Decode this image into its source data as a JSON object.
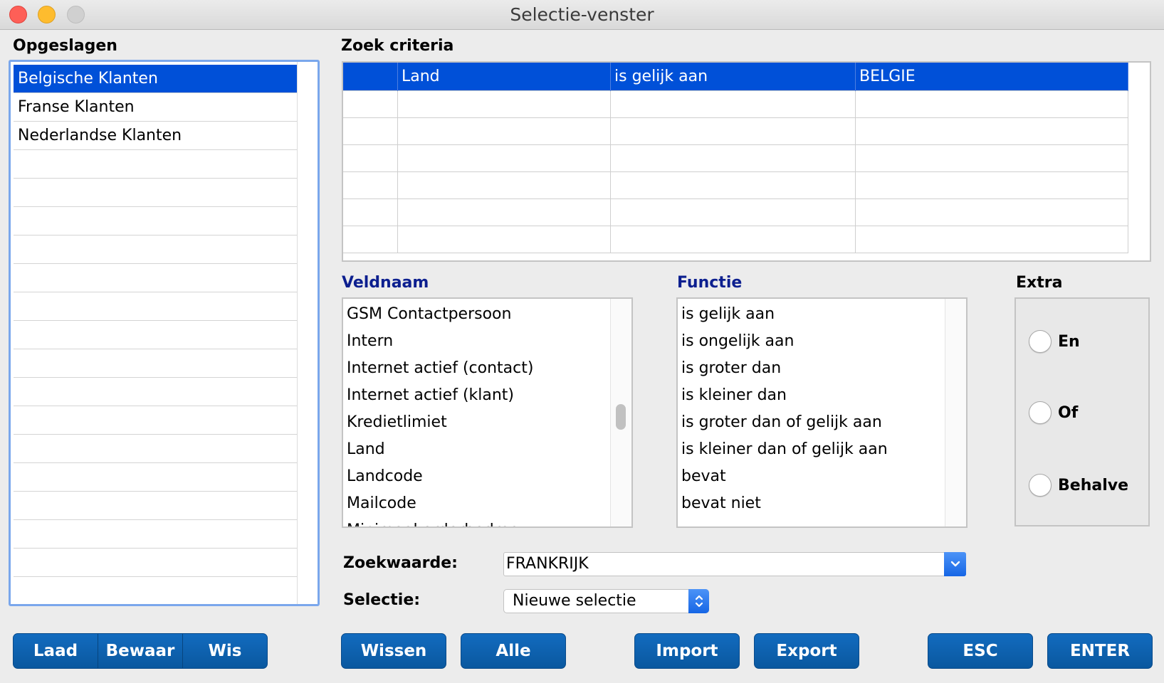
{
  "window": {
    "title": "Selectie-venster"
  },
  "saved": {
    "label": "Opgeslagen",
    "items": [
      {
        "label": "Belgische Klanten",
        "selected": true
      },
      {
        "label": "Franse Klanten",
        "selected": false
      },
      {
        "label": "Nederlandse Klanten",
        "selected": false
      },
      {
        "label": ""
      },
      {
        "label": ""
      },
      {
        "label": ""
      },
      {
        "label": ""
      },
      {
        "label": ""
      },
      {
        "label": ""
      },
      {
        "label": ""
      },
      {
        "label": ""
      },
      {
        "label": ""
      },
      {
        "label": ""
      },
      {
        "label": ""
      },
      {
        "label": ""
      },
      {
        "label": ""
      },
      {
        "label": ""
      },
      {
        "label": ""
      },
      {
        "label": ""
      }
    ]
  },
  "criteria": {
    "label": "Zoek criteria",
    "rows": [
      {
        "n": "",
        "field": "Land",
        "op": "is gelijk aan",
        "value": "BELGIE",
        "selected": true
      },
      {
        "n": "",
        "field": "",
        "op": "",
        "value": ""
      },
      {
        "n": "",
        "field": "",
        "op": "",
        "value": ""
      },
      {
        "n": "",
        "field": "",
        "op": "",
        "value": ""
      },
      {
        "n": "",
        "field": "",
        "op": "",
        "value": ""
      },
      {
        "n": "",
        "field": "",
        "op": "",
        "value": ""
      },
      {
        "n": "",
        "field": "",
        "op": "",
        "value": ""
      }
    ]
  },
  "fields": {
    "label": "Veldnaam",
    "items": [
      "GSM Contactpersoon",
      "Intern",
      "Internet actief (contact)",
      "Internet actief (klant)",
      "Kredietlimiet",
      "Land",
      "Landcode",
      "Mailcode",
      "Minimaal orderbedrag"
    ]
  },
  "functions": {
    "label": "Functie",
    "items": [
      "is gelijk aan",
      "is ongelijk aan",
      "is groter dan",
      "is kleiner dan",
      "is groter dan of gelijk aan",
      "is kleiner dan of gelijk aan",
      "bevat",
      "bevat niet"
    ]
  },
  "extra": {
    "label": "Extra",
    "options": [
      "En",
      "Of",
      "Behalve"
    ]
  },
  "form": {
    "search_label": "Zoekwaarde:",
    "search_value": "FRANKRIJK",
    "selection_label": "Selectie:",
    "selection_value": "Nieuwe selectie"
  },
  "buttons": {
    "load": "Laad",
    "save": "Bewaar",
    "delete": "Wis",
    "clear": "Wissen",
    "all": "Alle",
    "import": "Import",
    "export": "Export",
    "esc": "ESC",
    "enter": "ENTER"
  },
  "colors": {
    "selection": "#0050d8",
    "button": "#0b5aa6",
    "section_heading_blue": "#0c1f8f"
  }
}
